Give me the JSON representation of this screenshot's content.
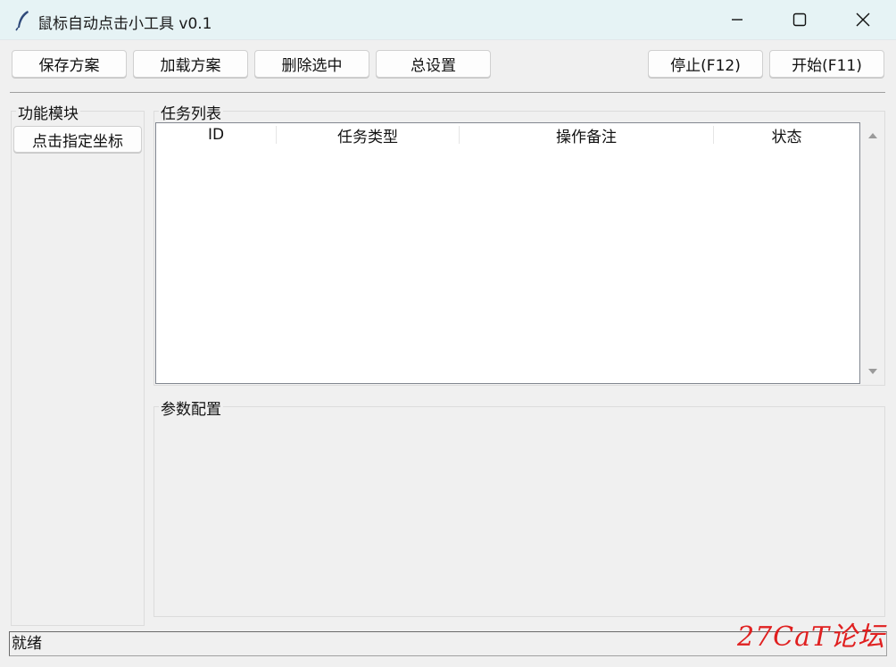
{
  "window": {
    "title": "鼠标自动点击小工具 v0.1",
    "icon": "feather-icon",
    "controls": {
      "minimize": "minimize-icon",
      "maximize": "maximize-icon",
      "close": "close-icon"
    }
  },
  "toolbar": {
    "save_label": "保存方案",
    "load_label": "加载方案",
    "delete_label": "删除选中",
    "settings_label": "总设置",
    "stop_label": "停止(F12)",
    "start_label": "开始(F11)"
  },
  "modules": {
    "title": "功能模块",
    "items": [
      {
        "label": "点击指定坐标"
      }
    ]
  },
  "tasks": {
    "title": "任务列表",
    "columns": [
      "ID",
      "任务类型",
      "操作备注",
      "状态"
    ],
    "rows": []
  },
  "params": {
    "title": "参数配置"
  },
  "status": {
    "text": "就绪"
  },
  "watermark": {
    "text": "27CaT论坛",
    "color": "#e02020"
  }
}
